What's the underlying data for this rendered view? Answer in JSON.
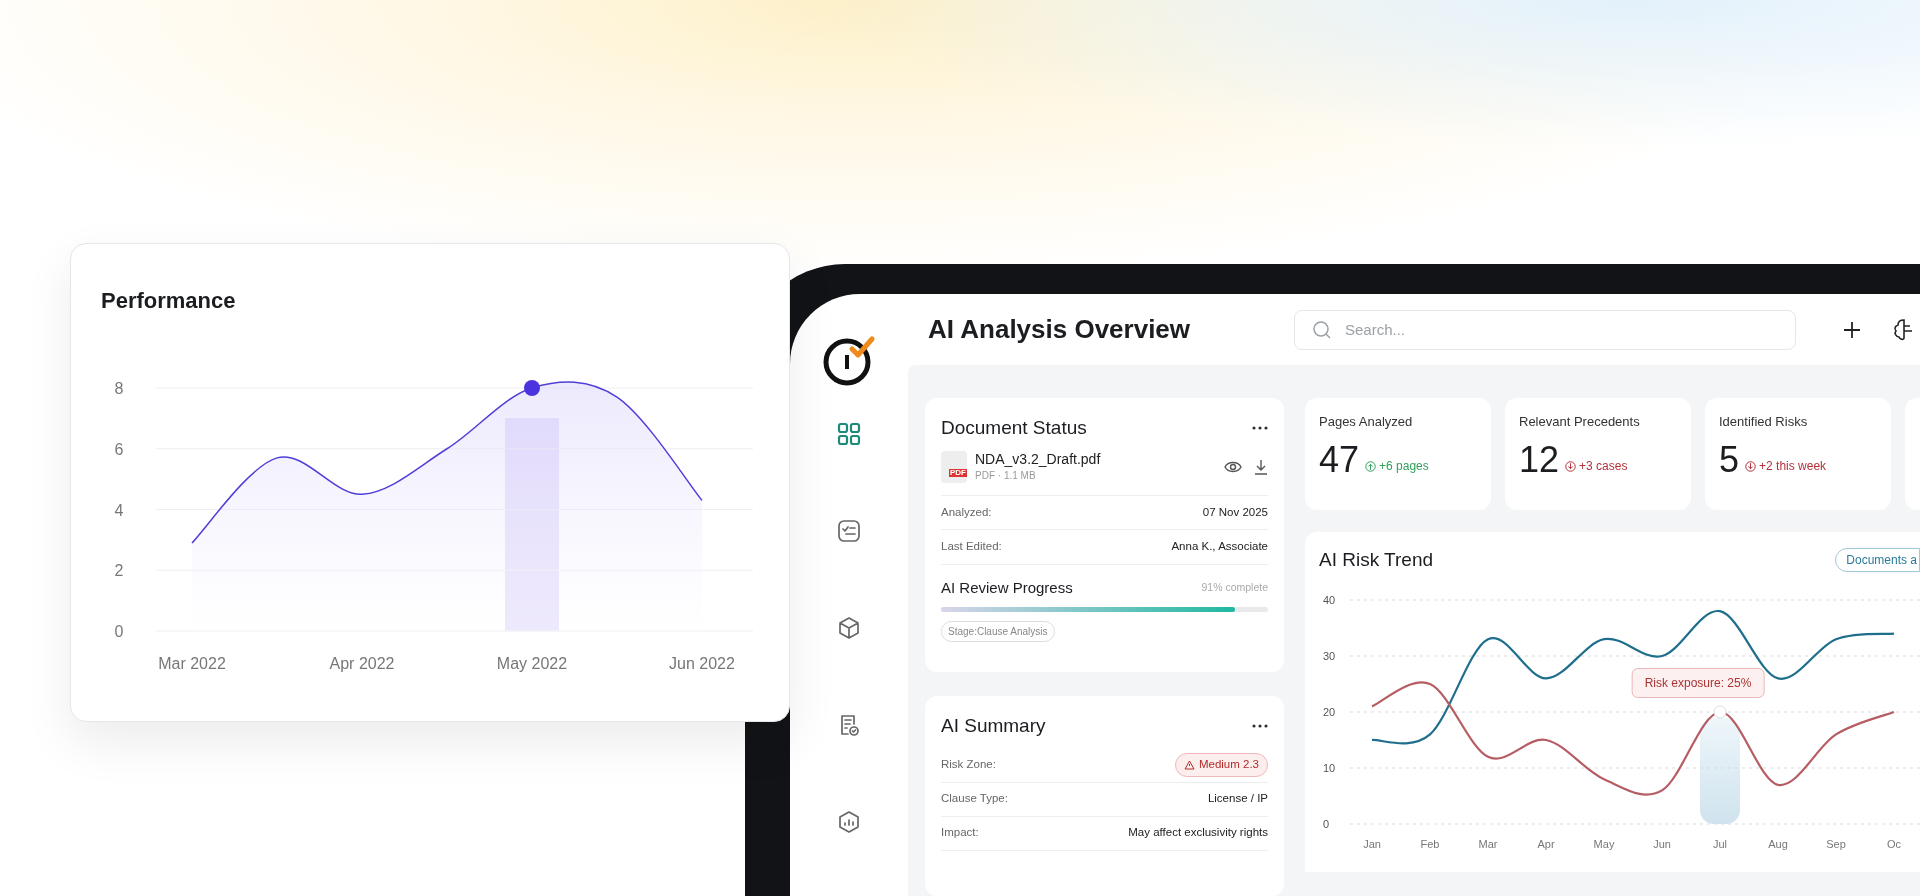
{
  "performance_card": {
    "title": "Performance",
    "chart_data": {
      "type": "area",
      "grid": true,
      "categories": [
        "Mar 2022",
        null,
        "Apr 2022",
        null,
        "May 2022",
        null,
        "Jun 2022"
      ],
      "series": [
        {
          "color": "#4f3fd6",
          "values": [
            2.9,
            5.7,
            4.5,
            6,
            8,
            7.7,
            4.3
          ]
        }
      ],
      "yticks": [
        0,
        2,
        4,
        6,
        8
      ],
      "ylim": [
        0,
        8
      ]
    }
  },
  "sidebar": {
    "items": [
      {
        "selected": true
      },
      {
        "selected": false
      },
      {
        "selected": false
      },
      {
        "selected": false
      },
      {
        "selected": false
      }
    ]
  },
  "header": {
    "title": "AI Analysis Overview",
    "search": {
      "placeholder": "Search..."
    }
  },
  "document_status": {
    "title": "Document Status",
    "file": {
      "name": "NDA_v3.2_Draft.pdf",
      "meta": "PDF · 1.1 MB",
      "badge": "PDF"
    },
    "details": [
      {
        "label": "Analyzed:",
        "value": "07 Nov 2025"
      },
      {
        "label": "Last Edited:",
        "value": "Anna K., Associate"
      }
    ],
    "progress": {
      "title": "AI Review Progress",
      "reading": "91% complete",
      "level": 0.9
    },
    "stage": "Stage:Clause Analysis"
  },
  "ai_summary": {
    "title": "AI Summary",
    "rows": [
      {
        "kind": "badge",
        "label": "Risk Zone:",
        "value": "Medium 2.3"
      },
      {
        "kind": "text",
        "label": "Clause Type:",
        "value": "License / IP"
      },
      {
        "kind": "text",
        "label": "Impact:",
        "value": "May affect exclusivity rights"
      }
    ]
  },
  "stats": [
    {
      "label": "Pages Analyzed",
      "value": "47",
      "delta": "+6 pages",
      "kind": "up"
    },
    {
      "label": "Relevant Precedents",
      "value": "12",
      "delta": "+3 cases",
      "kind": "down"
    },
    {
      "label": "Identified Risks",
      "value": "5",
      "delta": "+2 this week",
      "kind": "down"
    }
  ],
  "risk_trend": {
    "title": "AI Risk Trend",
    "filter": "Documents a",
    "tooltip": "Risk exposure: 25%",
    "chart_data": {
      "type": "line",
      "grid": true,
      "categories": [
        "Jan",
        "Feb",
        "Mar",
        "Apr",
        "May",
        "Jun",
        "Jul",
        "Aug",
        "Sep",
        "Oc"
      ],
      "series": [
        {
          "color": "#1f6e8c",
          "values": [
            15,
            16,
            33,
            26,
            33,
            30,
            38,
            26,
            33,
            34
          ]
        },
        {
          "color": "#b65c63",
          "values": [
            21,
            25,
            12,
            15,
            8,
            6,
            20,
            7,
            16,
            20
          ]
        }
      ],
      "yticks": [
        0,
        10,
        20,
        30,
        40
      ],
      "ylim": [
        0,
        40
      ]
    }
  }
}
